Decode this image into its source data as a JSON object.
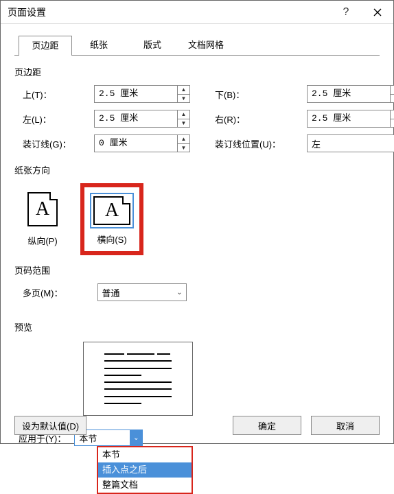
{
  "titlebar": {
    "title": "页面设置"
  },
  "tabs": {
    "margins": "页边距",
    "paper": "纸张",
    "layout": "版式",
    "docgrid": "文档网格"
  },
  "sections": {
    "margins_label": "页边距",
    "orientation_label": "纸张方向",
    "pagerange_label": "页码范围",
    "preview_label": "预览"
  },
  "margins": {
    "top_label": "上(T)：",
    "top_value": "2.5 厘米",
    "bottom_label": "下(B)：",
    "bottom_value": "2.5 厘米",
    "left_label": "左(L)：",
    "left_value": "2.5 厘米",
    "right_label": "右(R)：",
    "right_value": "2.5 厘米",
    "gutter_label": "装订线(G)：",
    "gutter_value": "0 厘米",
    "gutter_pos_label": "装订线位置(U)：",
    "gutter_pos_value": "左"
  },
  "orientation": {
    "portrait_label": "纵向(P)",
    "landscape_label": "横向(S)",
    "glyph": "A"
  },
  "pagerange": {
    "multi_label": "多页(M)：",
    "multi_value": "普通"
  },
  "apply": {
    "label": "应用于(Y)：",
    "value": "本节",
    "options": {
      "opt1": "本节",
      "opt2": "插入点之后",
      "opt3": "整篇文档"
    }
  },
  "footer": {
    "default_label": "设为默认值(D)",
    "ok": "确定",
    "cancel": "取消"
  }
}
